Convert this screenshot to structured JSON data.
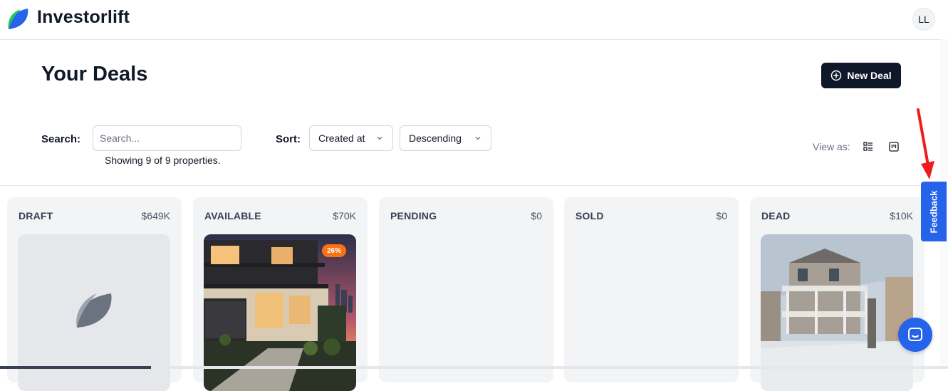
{
  "app": {
    "brand": "Investorlift",
    "avatar_initials": "LL"
  },
  "page": {
    "title": "Your Deals",
    "new_deal_label": "New Deal"
  },
  "filters": {
    "search_label": "Search:",
    "search_placeholder": "Search...",
    "search_value": "",
    "showing_text": "Showing 9 of 9 properties.",
    "sort_label": "Sort:",
    "sort_field": "Created at",
    "sort_order": "Descending",
    "view_as_label": "View as:"
  },
  "columns": [
    {
      "title": "DRAFT",
      "total": "$649K",
      "card": "placeholder"
    },
    {
      "title": "AVAILABLE",
      "total": "$70K",
      "card": "modern-house",
      "badge": "26%"
    },
    {
      "title": "PENDING",
      "total": "$0",
      "card": null
    },
    {
      "title": "SOLD",
      "total": "$0",
      "card": null
    },
    {
      "title": "DEAD",
      "total": "$10K",
      "card": "victorian-house"
    }
  ],
  "widgets": {
    "feedback_label": "Feedback"
  },
  "colors": {
    "primary_dark": "#0f172a",
    "feedback_blue": "#2563eb",
    "badge_orange": "#f97316",
    "column_bg": "#f3f4f6",
    "annotation_red": "#ef1c1c"
  }
}
